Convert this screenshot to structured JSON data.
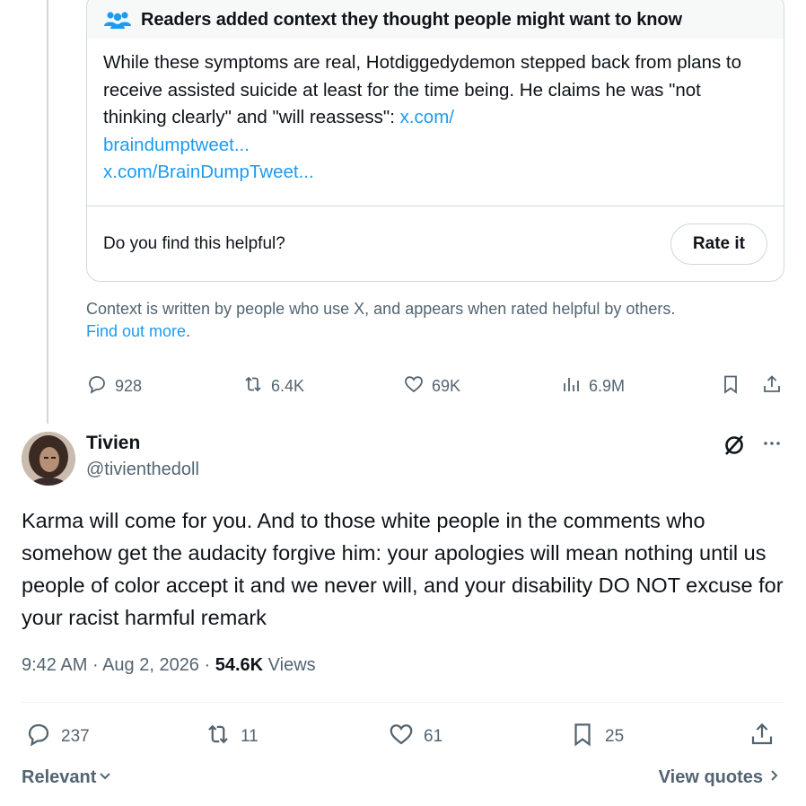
{
  "note": {
    "title": "Readers added context they thought people might want to know",
    "body": "While these symptoms are real, Hotdiggedydemon stepped back from plans to receive assisted suicide at least for the time being. He claims he was \"not thinking clearly\" and \"will reassess\": ",
    "link1a": "x.com/",
    "link1b": "braindumptweet...",
    "link2": "x.com/BrainDumpTweet...",
    "question": "Do you find this helpful?",
    "rate_label": "Rate it"
  },
  "context": {
    "text": "Context is written by people who use X, and appears when rated helpful by others.",
    "find_more": "Find out more",
    "period": "."
  },
  "parent_actions": {
    "replies": "928",
    "reposts": "6.4K",
    "likes": "69K",
    "views": "6.9M"
  },
  "reply": {
    "name": "Tivien",
    "handle": "@tivienthedoll",
    "text": "Karma will come for you. And to those white people in the comments who somehow get the audacity forgive him: your apologies will mean nothing until us people of color accept it and we never will, and your disability DO NOT excuse for your racist harmful remark",
    "time": "9:42 AM",
    "sep1": " · ",
    "date": "Aug 2, 2026",
    "sep2": " · ",
    "views_count": "54.6K",
    "views_label": " Views",
    "actions": {
      "replies": "237",
      "reposts": "11",
      "likes": "61",
      "bookmarks": "25"
    }
  },
  "footer": {
    "sort_label": "Relevant",
    "quotes_label": "View quotes"
  },
  "colors": {
    "accent": "#1d9bf0",
    "muted": "#536471",
    "border": "#cfd9de"
  },
  "icons": [
    "people-icon",
    "reply-icon",
    "repost-icon",
    "like-icon",
    "views-icon",
    "bookmark-icon",
    "share-icon",
    "grok-icon",
    "more-icon",
    "chevron-down-icon",
    "chevron-right-icon"
  ]
}
